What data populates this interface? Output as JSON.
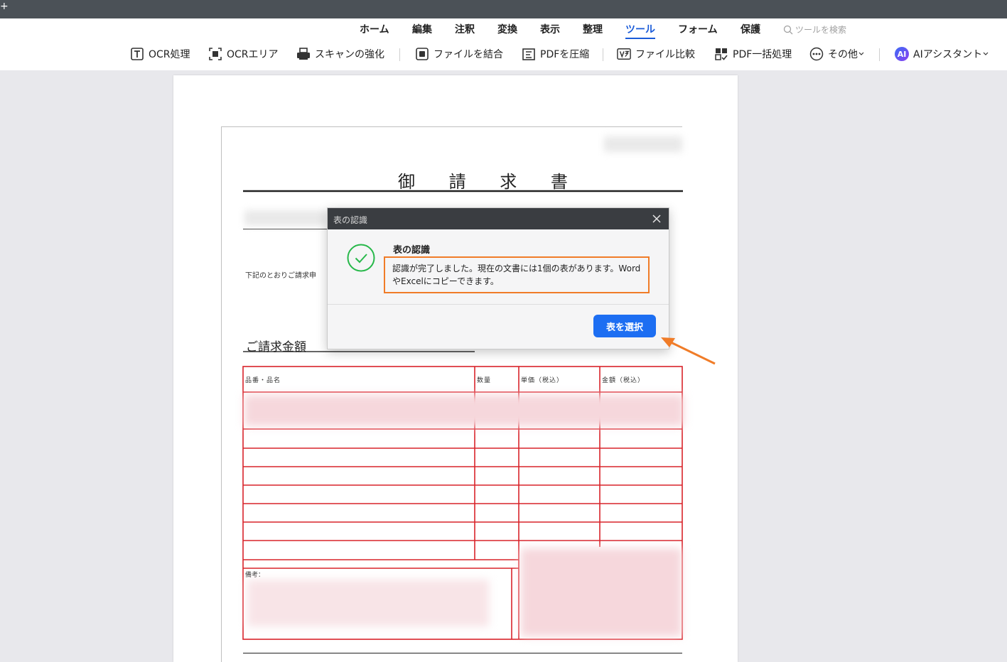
{
  "window": {
    "new_tab": "+"
  },
  "menu": {
    "items": [
      "ホーム",
      "編集",
      "注釈",
      "変換",
      "表示",
      "整理",
      "ツール",
      "フォーム",
      "保護"
    ],
    "active": "ツール",
    "search_placeholder": "ツールを検索"
  },
  "toolbar": {
    "ocr": "OCR処理",
    "ocr_area": "OCRエリア",
    "scan_enhance": "スキャンの強化",
    "combine": "ファイルを結合",
    "compress": "PDFを圧縮",
    "compare": "ファイル比較",
    "batch": "PDF一括処理",
    "more": "その他",
    "ai_badge": "AI",
    "ai_assistant": "AIアシスタント"
  },
  "document": {
    "title": "御 請 求 書",
    "intro": "下記のとおりご請求申",
    "amount_label": "ご請求金額",
    "table_headers": [
      "品番・品名",
      "数量",
      "単価（税込）",
      "金額（税込）"
    ],
    "remarks_label": "備考："
  },
  "dialog": {
    "window_title": "表の認識",
    "heading": "表の認識",
    "message": "認識が完了しました。現在の文書には1個の表があります。WordやExcelにコピーできます。",
    "select_button": "表を選択"
  },
  "colors": {
    "accent": "#1d6ef2",
    "highlight": "#f07c28",
    "table_border": "#d9232a",
    "success": "#27b84a"
  }
}
